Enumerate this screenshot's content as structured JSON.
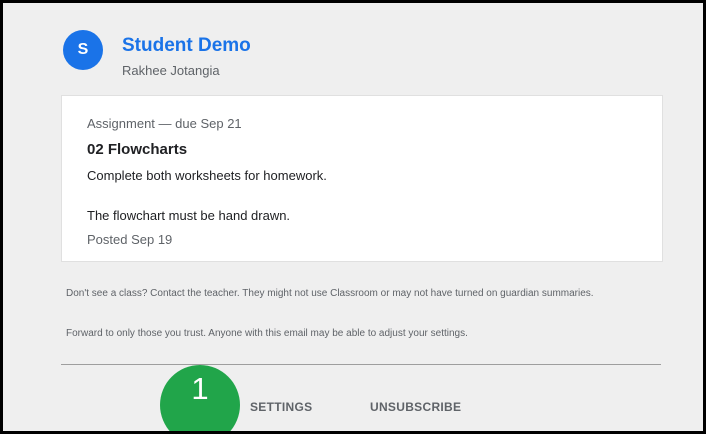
{
  "header": {
    "avatar_initial": "S",
    "class_name": "Student Demo",
    "teacher_name": "Rakhee Jotangia"
  },
  "assignment": {
    "due_line": "Assignment — due Sep 21",
    "title": "02 Flowcharts",
    "description_line1": "Complete both worksheets for homework.",
    "description_line2": "The flowchart must be hand drawn.",
    "posted": "Posted Sep 19"
  },
  "notices": {
    "missing_class": "Don't see a class? Contact the teacher. They might not use Classroom or may not have turned on guardian summaries.",
    "forward_warning": "Forward to only those you trust. Anyone with this email may be able to adjust your settings."
  },
  "footer": {
    "step_number": "1",
    "settings_label": "SETTINGS",
    "unsubscribe_label": "UNSUBSCRIBE"
  },
  "colors": {
    "accent": "#1a73e8",
    "step_marker": "#21a54a",
    "background": "#efefef"
  }
}
